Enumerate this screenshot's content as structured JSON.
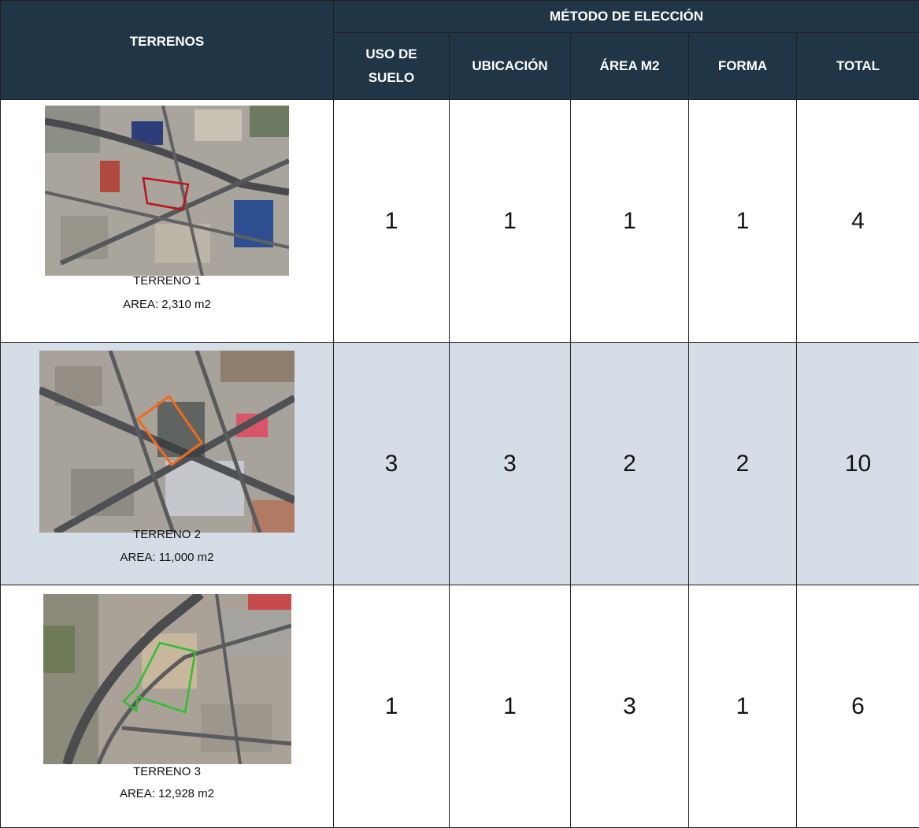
{
  "header": {
    "terrenos": "TERRENOS",
    "metodo": "MÉTODO DE ELECCIÓN",
    "columns": [
      {
        "line1": "USO DE",
        "line2": "SUELO"
      },
      {
        "line1": "UBICACIÓN",
        "line2": ""
      },
      {
        "line1": "ÁREA M2",
        "line2": ""
      },
      {
        "line1": "FORMA",
        "line2": ""
      },
      {
        "line1": "TOTAL",
        "line2": ""
      }
    ]
  },
  "rows": [
    {
      "name": "TERRENO 1",
      "area": "AREA: 2,310 m2",
      "outline_color": "#c0121b",
      "uso_suelo": "1",
      "ubicacion": "1",
      "area_m2": "1",
      "forma": "1",
      "total": "4"
    },
    {
      "name": "TERRENO 2",
      "area": "AREA: 11,000 m2",
      "outline_color": "#f26a1b",
      "uso_suelo": "3",
      "ubicacion": "3",
      "area_m2": "2",
      "forma": "2",
      "total": "10"
    },
    {
      "name": "TERRENO 3",
      "area": "AREA: 12,928 m2",
      "outline_color": "#2fbf2f",
      "uso_suelo": "1",
      "ubicacion": "1",
      "area_m2": "3",
      "forma": "1",
      "total": "6"
    }
  ],
  "colors": {
    "header_bg": "#203546",
    "shaded_row": "#d5dde6"
  }
}
